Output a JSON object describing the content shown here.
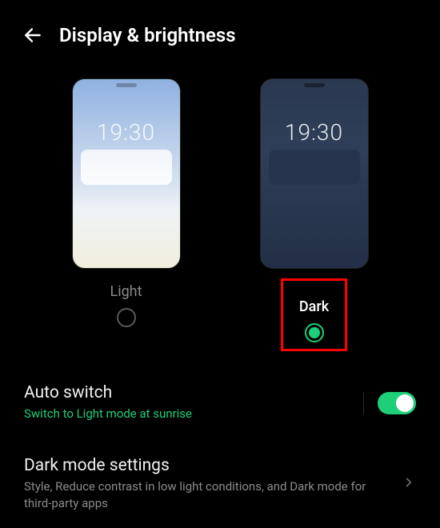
{
  "header": {
    "title": "Display & brightness"
  },
  "themes": {
    "preview_time": "19:30",
    "light_label": "Light",
    "dark_label": "Dark",
    "selected": "dark"
  },
  "auto_switch": {
    "title": "Auto switch",
    "subtitle": "Switch to Light mode at sunrise",
    "enabled": true
  },
  "dark_mode_settings": {
    "title": "Dark mode settings",
    "subtitle": "Style, Reduce contrast in low light conditions, and Dark mode for third-party apps"
  }
}
